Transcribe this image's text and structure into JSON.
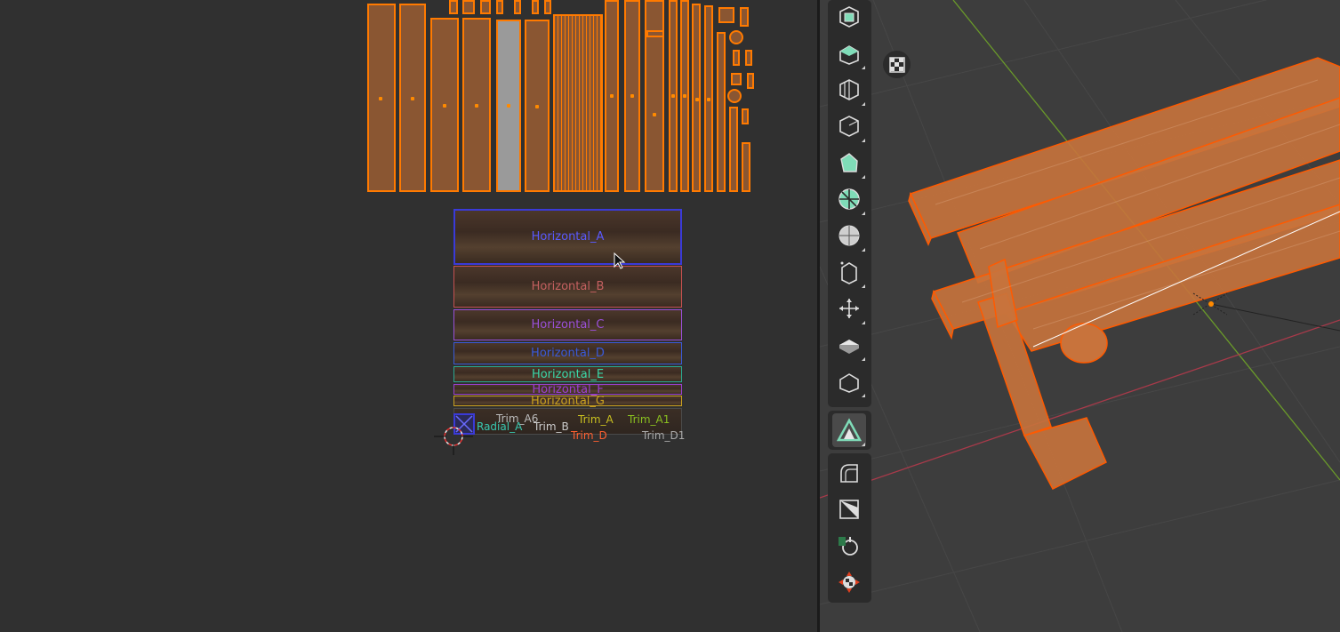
{
  "uv_editor": {
    "trim_labels": {
      "horizontal_a": "Horizontal_A",
      "horizontal_b": "Horizontal_B",
      "horizontal_c": "Horizontal_C",
      "horizontal_d": "Horizontal_D",
      "horizontal_e": "Horizontal_E",
      "horizontal_f": "Horizontal_F",
      "horizontal_g": "Horizontal_G",
      "trim_a6": "Trim_A6",
      "trim_a": "Trim_A",
      "trim_a1": "Trim_A1",
      "radial_a": "Radial_A",
      "trim_b": "Trim_B",
      "trim_d": "Trim_D",
      "trim_d1": "Trim_D1"
    },
    "label_colors": {
      "horizontal_a": "#5a5aff",
      "horizontal_b": "#c46060",
      "horizontal_c": "#9a50d8",
      "horizontal_d": "#3a5ad8",
      "horizontal_e": "#3ad8a8",
      "horizontal_f": "#9a40d0",
      "horizontal_g": "#c9a020",
      "trim_a": "#c9c020",
      "trim_a1": "#8ac020",
      "radial_a": "#38c8b0",
      "trim_b": "#cccccc",
      "trim_d": "#ff6030",
      "trim_d1": "#aaaaaa"
    },
    "selection_color": "#ff7a00"
  },
  "toolbar": {
    "tools": [
      {
        "name": "add-cube-icon",
        "active": false
      },
      {
        "name": "extrude-region-icon",
        "active": false
      },
      {
        "name": "inset-faces-icon",
        "active": false
      },
      {
        "name": "bevel-icon",
        "active": false
      },
      {
        "name": "loop-cut-icon",
        "active": false
      },
      {
        "name": "knife-icon",
        "active": false
      },
      {
        "name": "poly-build-icon",
        "active": false
      },
      {
        "name": "spin-icon",
        "active": false
      },
      {
        "name": "smooth-icon",
        "active": false
      },
      {
        "name": "edge-slide-icon",
        "active": false
      },
      {
        "name": "shrink-fatten-icon",
        "active": false
      },
      {
        "name": "shear-icon",
        "active": false
      },
      {
        "name": "rip-region-icon",
        "active": false
      },
      {
        "name": "trim-tool-icon",
        "active": true
      },
      {
        "name": "curve-tool-icon",
        "active": false
      },
      {
        "name": "transform-icon",
        "active": false
      },
      {
        "name": "rotate-icon",
        "active": false
      },
      {
        "name": "move-cursor-icon",
        "active": false
      }
    ],
    "accent": "#7fdcb8"
  },
  "viewport": {
    "gizmo_button": "checker-icon",
    "object_color": "#c8733c",
    "outline_color": "#ff5a00",
    "axis_x_color": "#a83a4a",
    "axis_y_color": "#6a9a2a"
  }
}
